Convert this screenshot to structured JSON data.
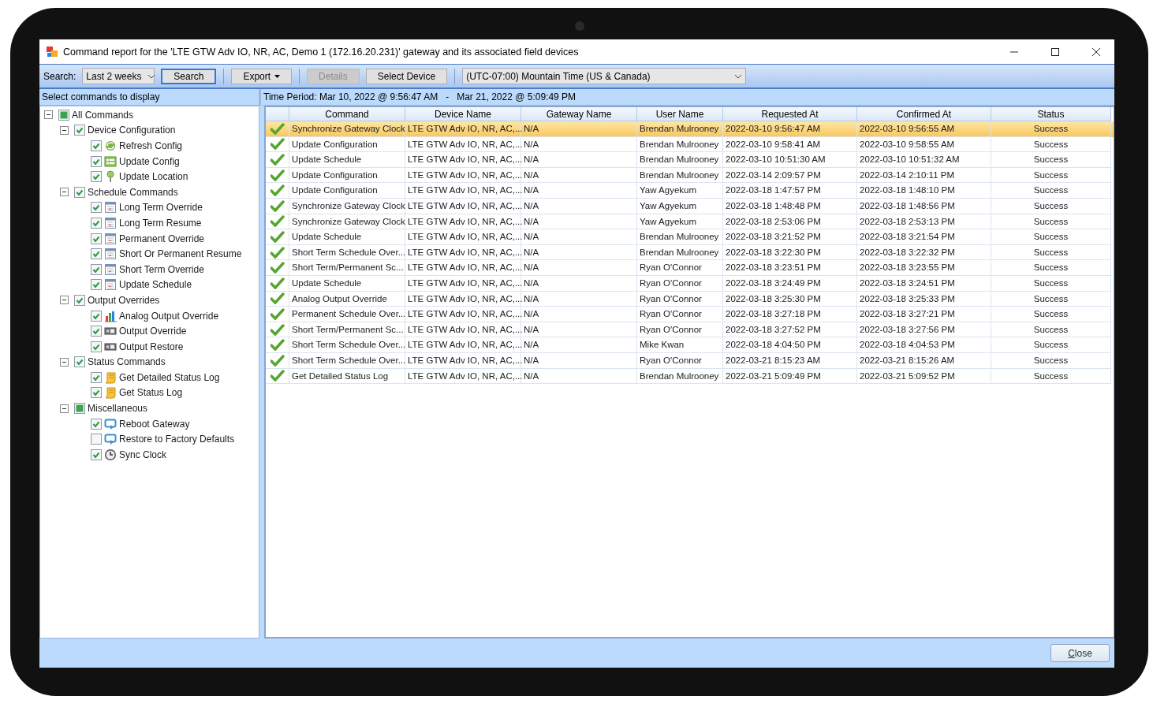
{
  "window": {
    "title": "Command report for the 'LTE GTW Adv IO, NR, AC, Demo 1 (172.16.20.231)' gateway and its associated field devices"
  },
  "toolbar": {
    "groups": [
      [
        {
          "kind": "label",
          "text": "Search:"
        },
        {
          "kind": "dropdown",
          "text": "Last 2 weeks"
        },
        {
          "kind": "button",
          "text": "Search",
          "disabled": false,
          "focused": true
        }
      ],
      [
        {
          "kind": "menu_button",
          "text": "Export",
          "disabled": false,
          "focused": false
        }
      ],
      [
        {
          "kind": "button",
          "text": "Details",
          "disabled": true,
          "focused": false
        },
        {
          "kind": "button",
          "text": "Select Device",
          "disabled": false,
          "focused": false
        }
      ],
      [
        {
          "kind": "dropdown",
          "text": "(UTC-07:00) Mountain Time (US & Canada)"
        }
      ]
    ]
  },
  "tree_header": "Select commands to display",
  "time_period": "Time Period: Mar 10, 2022 @ 9:56:47 AM   -   Mar 21, 2022 @ 5:09:49 PM",
  "tree": [
    {
      "label": "All Commands",
      "checked": true,
      "mixed": true,
      "expanded": true,
      "children": [
        {
          "label": "Device Configuration",
          "checked": true,
          "mixed": false,
          "expanded": true,
          "children": [
            {
              "label": "Refresh Config",
              "checked": true,
              "kind": "refresh"
            },
            {
              "label": "Update Config",
              "checked": true,
              "kind": "config"
            },
            {
              "label": "Update Location",
              "checked": true,
              "kind": "location"
            }
          ]
        },
        {
          "label": "Schedule Commands",
          "checked": true,
          "mixed": false,
          "expanded": true,
          "children": [
            {
              "label": "Long Term Override",
              "checked": true,
              "kind": "schedule"
            },
            {
              "label": "Long Term Resume",
              "checked": true,
              "kind": "schedule"
            },
            {
              "label": "Permanent Override",
              "checked": true,
              "kind": "schedule"
            },
            {
              "label": "Short Or Permanent Resume",
              "checked": true,
              "kind": "schedule"
            },
            {
              "label": "Short Term Override",
              "checked": true,
              "kind": "schedule"
            },
            {
              "label": "Update Schedule",
              "checked": true,
              "kind": "schedule"
            }
          ]
        },
        {
          "label": "Output Overrides",
          "checked": true,
          "mixed": false,
          "expanded": true,
          "children": [
            {
              "label": "Analog Output Override",
              "checked": true,
              "kind": "chart"
            },
            {
              "label": "Output Override",
              "checked": true,
              "kind": "output"
            },
            {
              "label": "Output Restore",
              "checked": true,
              "kind": "output"
            }
          ]
        },
        {
          "label": "Status Commands",
          "checked": true,
          "mixed": false,
          "expanded": true,
          "children": [
            {
              "label": "Get Detailed Status Log",
              "checked": true,
              "kind": "log"
            },
            {
              "label": "Get Status Log",
              "checked": true,
              "kind": "log"
            }
          ]
        },
        {
          "label": "Miscellaneous",
          "checked": true,
          "mixed": true,
          "expanded": true,
          "children": [
            {
              "label": "Reboot Gateway",
              "checked": true,
              "kind": "reboot"
            },
            {
              "label": "Restore to Factory Defaults",
              "checked": false,
              "kind": "reboot"
            },
            {
              "label": "Sync Clock",
              "checked": true,
              "kind": "clock"
            }
          ]
        }
      ]
    }
  ],
  "table": {
    "columns": [
      "Command",
      "Device Name",
      "Gateway Name",
      "User Name",
      "Requested At",
      "Confirmed At",
      "Status"
    ],
    "rows": [
      {
        "selected": true,
        "kind": "success",
        "cells": [
          "Synchronize Gateway Clock",
          "LTE GTW Adv IO, NR, AC,...",
          "N/A",
          "Brendan Mulrooney",
          "2022-03-10 9:56:47 AM",
          "2022-03-10 9:56:55 AM",
          "Success"
        ]
      },
      {
        "selected": false,
        "kind": "success",
        "cells": [
          "Update Configuration",
          "LTE GTW Adv IO, NR, AC,...",
          "N/A",
          "Brendan Mulrooney",
          "2022-03-10 9:58:41 AM",
          "2022-03-10 9:58:55 AM",
          "Success"
        ]
      },
      {
        "selected": false,
        "kind": "success",
        "cells": [
          "Update Schedule",
          "LTE GTW Adv IO, NR, AC,...",
          "N/A",
          "Brendan Mulrooney",
          "2022-03-10 10:51:30 AM",
          "2022-03-10 10:51:32 AM",
          "Success"
        ]
      },
      {
        "selected": false,
        "kind": "success",
        "cells": [
          "Update Configuration",
          "LTE GTW Adv IO, NR, AC,...",
          "N/A",
          "Brendan Mulrooney",
          "2022-03-14 2:09:57 PM",
          "2022-03-14 2:10:11 PM",
          "Success"
        ]
      },
      {
        "selected": false,
        "kind": "success",
        "cells": [
          "Update Configuration",
          "LTE GTW Adv IO, NR, AC,...",
          "N/A",
          "Yaw Agyekum",
          "2022-03-18 1:47:57 PM",
          "2022-03-18 1:48:10 PM",
          "Success"
        ]
      },
      {
        "selected": false,
        "kind": "success",
        "cells": [
          "Synchronize Gateway Clock",
          "LTE GTW Adv IO, NR, AC,...",
          "N/A",
          "Yaw Agyekum",
          "2022-03-18 1:48:48 PM",
          "2022-03-18 1:48:56 PM",
          "Success"
        ]
      },
      {
        "selected": false,
        "kind": "success",
        "cells": [
          "Synchronize Gateway Clock",
          "LTE GTW Adv IO, NR, AC,...",
          "N/A",
          "Yaw Agyekum",
          "2022-03-18 2:53:06 PM",
          "2022-03-18 2:53:13 PM",
          "Success"
        ]
      },
      {
        "selected": false,
        "kind": "success",
        "cells": [
          "Update Schedule",
          "LTE GTW Adv IO, NR, AC,...",
          "N/A",
          "Brendan Mulrooney",
          "2022-03-18 3:21:52 PM",
          "2022-03-18 3:21:54 PM",
          "Success"
        ]
      },
      {
        "selected": false,
        "kind": "success",
        "cells": [
          "Short Term Schedule Over...",
          "LTE GTW Adv IO, NR, AC,...",
          "N/A",
          "Brendan Mulrooney",
          "2022-03-18 3:22:30 PM",
          "2022-03-18 3:22:32 PM",
          "Success"
        ]
      },
      {
        "selected": false,
        "kind": "success",
        "cells": [
          "Short Term/Permanent Sc...",
          "LTE GTW Adv IO, NR, AC,...",
          "N/A",
          "Ryan O'Connor",
          "2022-03-18 3:23:51 PM",
          "2022-03-18 3:23:55 PM",
          "Success"
        ]
      },
      {
        "selected": false,
        "kind": "success",
        "cells": [
          "Update Schedule",
          "LTE GTW Adv IO, NR, AC,...",
          "N/A",
          "Ryan O'Connor",
          "2022-03-18 3:24:49 PM",
          "2022-03-18 3:24:51 PM",
          "Success"
        ]
      },
      {
        "selected": false,
        "kind": "success",
        "cells": [
          "Analog Output Override",
          "LTE GTW Adv IO, NR, AC,...",
          "N/A",
          "Ryan O'Connor",
          "2022-03-18 3:25:30 PM",
          "2022-03-18 3:25:33 PM",
          "Success"
        ]
      },
      {
        "selected": false,
        "kind": "success",
        "cells": [
          "Permanent Schedule Over...",
          "LTE GTW Adv IO, NR, AC,...",
          "N/A",
          "Ryan O'Connor",
          "2022-03-18 3:27:18 PM",
          "2022-03-18 3:27:21 PM",
          "Success"
        ]
      },
      {
        "selected": false,
        "kind": "success",
        "cells": [
          "Short Term/Permanent Sc...",
          "LTE GTW Adv IO, NR, AC,...",
          "N/A",
          "Ryan O'Connor",
          "2022-03-18 3:27:52 PM",
          "2022-03-18 3:27:56 PM",
          "Success"
        ]
      },
      {
        "selected": false,
        "kind": "success",
        "cells": [
          "Short Term Schedule Over...",
          "LTE GTW Adv IO, NR, AC,...",
          "N/A",
          "Mike Kwan",
          "2022-03-18 4:04:50 PM",
          "2022-03-18 4:04:53 PM",
          "Success"
        ]
      },
      {
        "selected": false,
        "kind": "success",
        "cells": [
          "Short Term Schedule Over...",
          "LTE GTW Adv IO, NR, AC,...",
          "N/A",
          "Ryan O'Connor",
          "2022-03-21 8:15:23 AM",
          "2022-03-21 8:15:26 AM",
          "Success"
        ]
      },
      {
        "selected": false,
        "kind": "success",
        "cells": [
          "Get Detailed Status Log",
          "LTE GTW Adv IO, NR, AC,...",
          "N/A",
          "Brendan Mulrooney",
          "2022-03-21 5:09:49 PM",
          "2022-03-21 5:09:52 PM",
          "Success"
        ]
      }
    ]
  },
  "footer": {
    "close_button": "Close"
  }
}
